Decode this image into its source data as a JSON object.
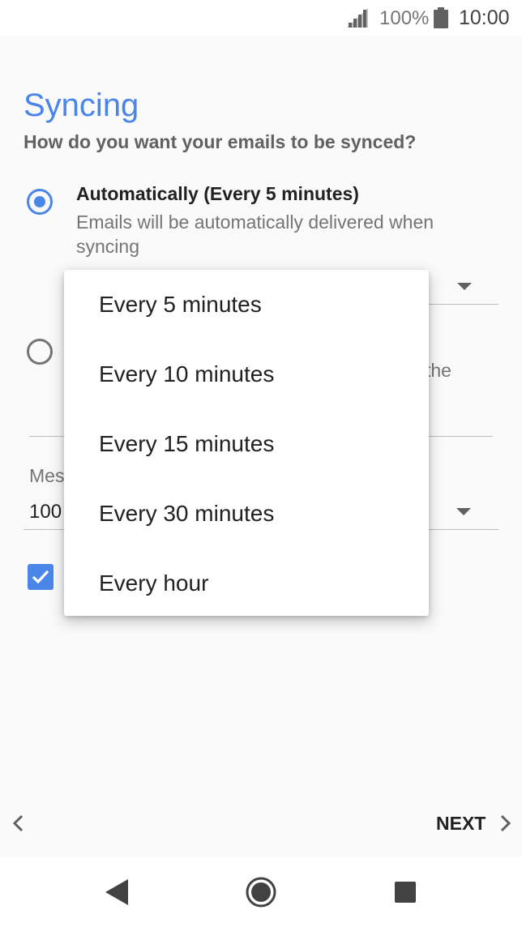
{
  "status_bar": {
    "battery_percent": "100%",
    "time": "10:00",
    "icons": [
      "signal-icon",
      "battery-icon"
    ]
  },
  "page": {
    "title": "Syncing",
    "subtitle": "How do you want your emails to be synced?"
  },
  "sync_options": [
    {
      "title": "Automatically (Every 5 minutes)",
      "description": "Emails will be automatically delivered when syncing",
      "selected": true
    },
    {
      "partial_text": "the",
      "selected": false
    }
  ],
  "messages_field": {
    "label": "Mes",
    "value": "100"
  },
  "checkbox": {
    "checked": true
  },
  "frequency_dropdown": {
    "options": [
      "Every 5 minutes",
      "Every 10 minutes",
      "Every 15 minutes",
      "Every 30 minutes",
      "Every hour"
    ]
  },
  "footer": {
    "next_label": "NEXT",
    "icons": [
      "chevron-left-icon",
      "chevron-right-icon"
    ]
  },
  "nav_bar": {
    "icons": [
      "back-icon",
      "home-icon",
      "recents-icon"
    ]
  },
  "colors": {
    "accent": "#4a86e8",
    "background": "#fafafa"
  }
}
